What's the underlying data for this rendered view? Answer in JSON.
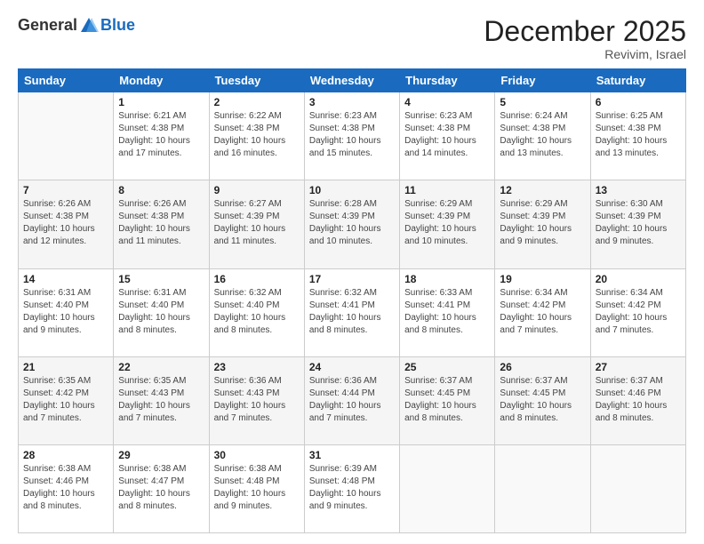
{
  "header": {
    "logo_general": "General",
    "logo_blue": "Blue",
    "month_year": "December 2025",
    "location": "Revivim, Israel"
  },
  "days_of_week": [
    "Sunday",
    "Monday",
    "Tuesday",
    "Wednesday",
    "Thursday",
    "Friday",
    "Saturday"
  ],
  "weeks": [
    [
      {
        "day": "",
        "info": ""
      },
      {
        "day": "1",
        "info": "Sunrise: 6:21 AM\nSunset: 4:38 PM\nDaylight: 10 hours\nand 17 minutes."
      },
      {
        "day": "2",
        "info": "Sunrise: 6:22 AM\nSunset: 4:38 PM\nDaylight: 10 hours\nand 16 minutes."
      },
      {
        "day": "3",
        "info": "Sunrise: 6:23 AM\nSunset: 4:38 PM\nDaylight: 10 hours\nand 15 minutes."
      },
      {
        "day": "4",
        "info": "Sunrise: 6:23 AM\nSunset: 4:38 PM\nDaylight: 10 hours\nand 14 minutes."
      },
      {
        "day": "5",
        "info": "Sunrise: 6:24 AM\nSunset: 4:38 PM\nDaylight: 10 hours\nand 13 minutes."
      },
      {
        "day": "6",
        "info": "Sunrise: 6:25 AM\nSunset: 4:38 PM\nDaylight: 10 hours\nand 13 minutes."
      }
    ],
    [
      {
        "day": "7",
        "info": "Sunrise: 6:26 AM\nSunset: 4:38 PM\nDaylight: 10 hours\nand 12 minutes."
      },
      {
        "day": "8",
        "info": "Sunrise: 6:26 AM\nSunset: 4:38 PM\nDaylight: 10 hours\nand 11 minutes."
      },
      {
        "day": "9",
        "info": "Sunrise: 6:27 AM\nSunset: 4:39 PM\nDaylight: 10 hours\nand 11 minutes."
      },
      {
        "day": "10",
        "info": "Sunrise: 6:28 AM\nSunset: 4:39 PM\nDaylight: 10 hours\nand 10 minutes."
      },
      {
        "day": "11",
        "info": "Sunrise: 6:29 AM\nSunset: 4:39 PM\nDaylight: 10 hours\nand 10 minutes."
      },
      {
        "day": "12",
        "info": "Sunrise: 6:29 AM\nSunset: 4:39 PM\nDaylight: 10 hours\nand 9 minutes."
      },
      {
        "day": "13",
        "info": "Sunrise: 6:30 AM\nSunset: 4:39 PM\nDaylight: 10 hours\nand 9 minutes."
      }
    ],
    [
      {
        "day": "14",
        "info": "Sunrise: 6:31 AM\nSunset: 4:40 PM\nDaylight: 10 hours\nand 9 minutes."
      },
      {
        "day": "15",
        "info": "Sunrise: 6:31 AM\nSunset: 4:40 PM\nDaylight: 10 hours\nand 8 minutes."
      },
      {
        "day": "16",
        "info": "Sunrise: 6:32 AM\nSunset: 4:40 PM\nDaylight: 10 hours\nand 8 minutes."
      },
      {
        "day": "17",
        "info": "Sunrise: 6:32 AM\nSunset: 4:41 PM\nDaylight: 10 hours\nand 8 minutes."
      },
      {
        "day": "18",
        "info": "Sunrise: 6:33 AM\nSunset: 4:41 PM\nDaylight: 10 hours\nand 8 minutes."
      },
      {
        "day": "19",
        "info": "Sunrise: 6:34 AM\nSunset: 4:42 PM\nDaylight: 10 hours\nand 7 minutes."
      },
      {
        "day": "20",
        "info": "Sunrise: 6:34 AM\nSunset: 4:42 PM\nDaylight: 10 hours\nand 7 minutes."
      }
    ],
    [
      {
        "day": "21",
        "info": "Sunrise: 6:35 AM\nSunset: 4:42 PM\nDaylight: 10 hours\nand 7 minutes."
      },
      {
        "day": "22",
        "info": "Sunrise: 6:35 AM\nSunset: 4:43 PM\nDaylight: 10 hours\nand 7 minutes."
      },
      {
        "day": "23",
        "info": "Sunrise: 6:36 AM\nSunset: 4:43 PM\nDaylight: 10 hours\nand 7 minutes."
      },
      {
        "day": "24",
        "info": "Sunrise: 6:36 AM\nSunset: 4:44 PM\nDaylight: 10 hours\nand 7 minutes."
      },
      {
        "day": "25",
        "info": "Sunrise: 6:37 AM\nSunset: 4:45 PM\nDaylight: 10 hours\nand 8 minutes."
      },
      {
        "day": "26",
        "info": "Sunrise: 6:37 AM\nSunset: 4:45 PM\nDaylight: 10 hours\nand 8 minutes."
      },
      {
        "day": "27",
        "info": "Sunrise: 6:37 AM\nSunset: 4:46 PM\nDaylight: 10 hours\nand 8 minutes."
      }
    ],
    [
      {
        "day": "28",
        "info": "Sunrise: 6:38 AM\nSunset: 4:46 PM\nDaylight: 10 hours\nand 8 minutes."
      },
      {
        "day": "29",
        "info": "Sunrise: 6:38 AM\nSunset: 4:47 PM\nDaylight: 10 hours\nand 8 minutes."
      },
      {
        "day": "30",
        "info": "Sunrise: 6:38 AM\nSunset: 4:48 PM\nDaylight: 10 hours\nand 9 minutes."
      },
      {
        "day": "31",
        "info": "Sunrise: 6:39 AM\nSunset: 4:48 PM\nDaylight: 10 hours\nand 9 minutes."
      },
      {
        "day": "",
        "info": ""
      },
      {
        "day": "",
        "info": ""
      },
      {
        "day": "",
        "info": ""
      }
    ]
  ]
}
